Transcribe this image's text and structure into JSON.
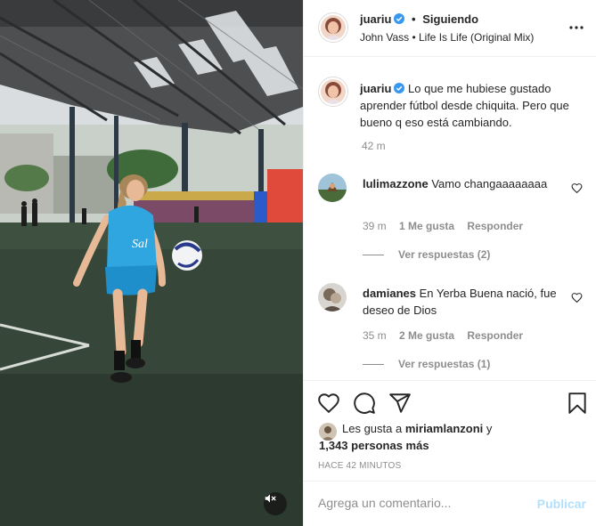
{
  "header": {
    "username": "juariu",
    "separator": "•",
    "follow_status": "Siguiendo",
    "audio": "John Vass • Life Is Life (Original Mix)"
  },
  "caption": {
    "username": "juariu",
    "text": "Lo que me hubiese gustado aprender fútbol desde chiquita. Pero que bueno q eso está cambiando.",
    "time": "42 m"
  },
  "comments": [
    {
      "username": "lulimazzone",
      "text": "Vamo changaaaaaaaa",
      "time": "39 m",
      "likes": "1 Me gusta",
      "reply": "Responder",
      "view_replies": "Ver respuestas (2)"
    },
    {
      "username": "damianes",
      "text": "En Yerba Buena nació, fue deseo de Dios",
      "time": "35 m",
      "likes": "2 Me gusta",
      "reply": "Responder",
      "view_replies": "Ver respuestas (1)"
    }
  ],
  "likes": {
    "prefix": "Les gusta a",
    "user": "miriamlanzoni",
    "connector": "y",
    "others": "1,343 personas más"
  },
  "timestamp": "HACE 42 MINUTOS",
  "comment_box": {
    "placeholder": "Agrega un comentario...",
    "publish": "Publicar"
  },
  "colors": {
    "verified": "#3897f0",
    "publish_disabled": "#b2dffc",
    "muted_text": "#8e8e8e"
  },
  "icons": [
    "verified-icon",
    "more-options-icon",
    "heart-icon",
    "comment-icon",
    "share-icon",
    "bookmark-icon",
    "muted-speaker-icon"
  ]
}
